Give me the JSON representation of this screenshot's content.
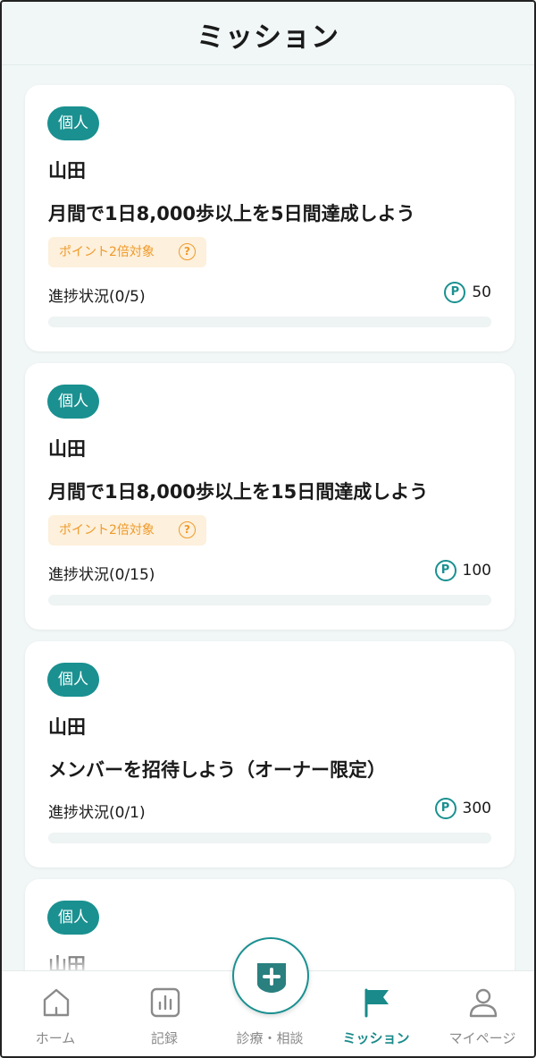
{
  "header": {
    "title": "ミッション"
  },
  "missions": [
    {
      "badge": "個人",
      "owner": "山田",
      "title": "月間で1日8,000歩以上を5日間達成しよう",
      "bonus": "ポイント2倍対象",
      "progress_label": "進捗状況(0/5)",
      "points": "50",
      "progress": 0
    },
    {
      "badge": "個人",
      "owner": "山田",
      "title": "月間で1日8,000歩以上を15日間達成しよう",
      "bonus": "ポイント2倍対象",
      "progress_label": "進捗状況(0/15)",
      "points": "100",
      "progress": 0
    },
    {
      "badge": "個人",
      "owner": "山田",
      "title": "メンバーを招待しよう（オーナー限定）",
      "progress_label": "進捗状況(0/1)",
      "points": "300",
      "progress": 0
    },
    {
      "badge": "個人",
      "owner": "山田"
    }
  ],
  "icons": {
    "help": "?",
    "point": "P"
  },
  "nav": {
    "home": "ホーム",
    "records": "記録",
    "consult": "診療・相談",
    "missions": "ミッション",
    "mypage": "マイページ"
  },
  "colors": {
    "accent": "#1a9090",
    "bonus_text": "#ee9a2a",
    "bonus_bg": "#fdf0dc"
  }
}
